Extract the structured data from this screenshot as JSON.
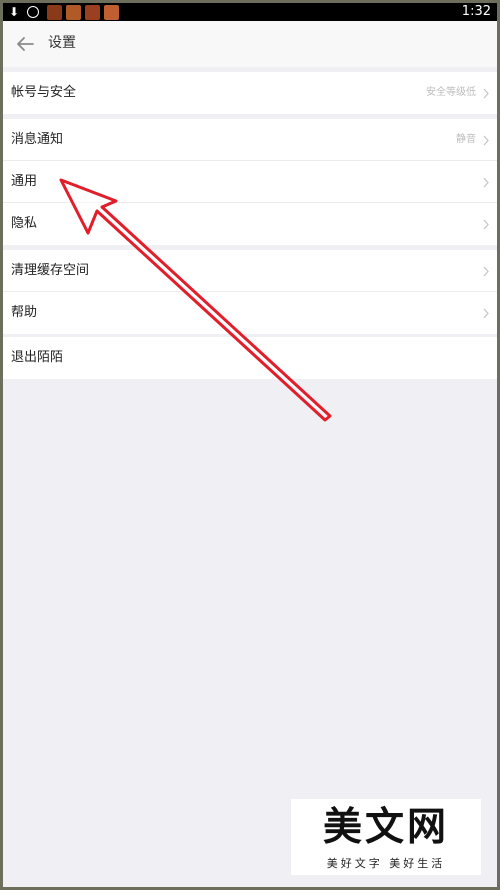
{
  "statusbar": {
    "time": "1:32",
    "icons": [
      "download-icon",
      "chat-notification-icon",
      "app-icon-1",
      "app-icon-2",
      "app-icon-3",
      "app-icon-4"
    ],
    "app_colors": [
      "#8a3a18",
      "#b05a28",
      "#9a4020",
      "#c06030"
    ]
  },
  "header": {
    "title": "设置"
  },
  "groups": [
    {
      "items": [
        {
          "label": "帐号与安全",
          "value": "安全等级低"
        }
      ]
    },
    {
      "items": [
        {
          "label": "消息通知",
          "value": "静音"
        },
        {
          "label": "通用",
          "value": ""
        },
        {
          "label": "隐私",
          "value": ""
        }
      ]
    },
    {
      "items": [
        {
          "label": "清理缓存空间",
          "value": ""
        },
        {
          "label": "帮助",
          "value": ""
        }
      ]
    },
    {
      "items": [
        {
          "label": "退出陌陌",
          "value": ""
        }
      ]
    }
  ],
  "watermark": {
    "logo": "美文网",
    "slogan": "美好文字 美好生活"
  },
  "colors": {
    "background": "#efeff4",
    "annotation_arrow": "#e11e2a",
    "header": "#f8f8f8"
  }
}
